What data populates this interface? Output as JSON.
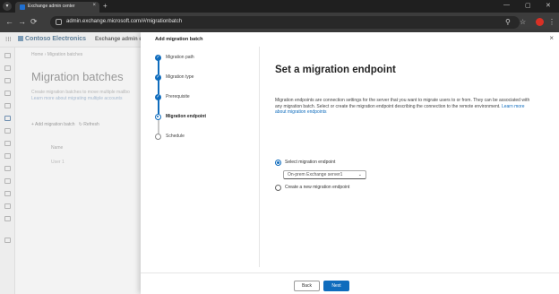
{
  "browser": {
    "tab_title": "Exchange admin center",
    "url": "admin.exchange.microsoft.com/#/migrationbatch",
    "new_tab": "+",
    "close_glyph": "×",
    "minimize_glyph": "—",
    "maximize_glyph": "▢",
    "window_close_glyph": "✕"
  },
  "app": {
    "brand": "Contoso Electronics",
    "app_name": "Exchange admin ce",
    "breadcrumb": "Home  ›  Migration batches",
    "page_title": "Migration batches",
    "description_line1": "Create migration batches to move multiple mailbo",
    "description_link": "Learn more about migrating multiple accounts",
    "toolbar_add": "Add migration batch",
    "toolbar_refresh": "Refresh",
    "col_name": "Name",
    "row_name": "User 1"
  },
  "panel": {
    "title": "Add migration batch",
    "close_glyph": "×",
    "steps": [
      {
        "label": "Migration path",
        "state": "done"
      },
      {
        "label": "Migration type",
        "state": "done"
      },
      {
        "label": "Prerequisite",
        "state": "done"
      },
      {
        "label": "Migration endpoint",
        "state": "current"
      },
      {
        "label": "Schedule",
        "state": "pending"
      }
    ],
    "heading": "Set a migration endpoint",
    "description": "Migration endpoints are connection settings for the server that you want to migrate users to or from. They can be associated with any migration batch. Select or create the migration endpoint describing the connection to the remote environment.",
    "description_link": "Learn more about migration endpoints",
    "option_select": "Select migration endpoint",
    "option_create": "Create a new migration endpoint",
    "dropdown_value": "On-prem Exchange server1",
    "back_label": "Back",
    "next_label": "Next"
  },
  "colors": {
    "accent": "#0f6cbd",
    "chrome_dark": "#1f1f1f",
    "profile": "#d93025"
  }
}
